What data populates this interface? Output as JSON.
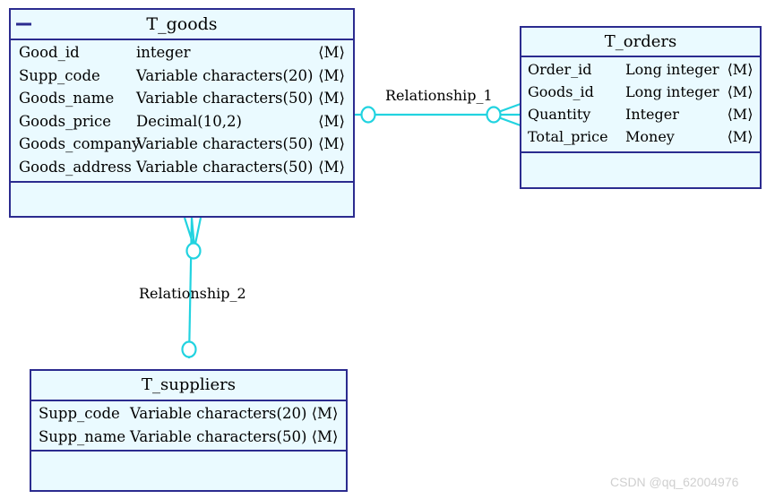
{
  "diagram": {
    "background_color": "#ffffff",
    "entity_border_color": "#2b2b8f",
    "entity_fill_color": "#eafaff",
    "relationship_color": "#22d3e0",
    "mandatory_marker": "⟨M⟩"
  },
  "entities": [
    {
      "id": "t_goods",
      "title": "T_goods",
      "has_collapse_dash": true,
      "attributes": [
        {
          "name": "Good_id",
          "type": "integer",
          "mandatory": "⟨M⟩"
        },
        {
          "name": "Supp_code",
          "type": "Variable characters(20)",
          "mandatory": "⟨M⟩"
        },
        {
          "name": "Goods_name",
          "type": "Variable characters(50)",
          "mandatory": "⟨M⟩"
        },
        {
          "name": "Goods_price",
          "type": "Decimal(10,2)",
          "mandatory": "⟨M⟩"
        },
        {
          "name": "Goods_company",
          "type": "Variable characters(50)",
          "mandatory": "⟨M⟩"
        },
        {
          "name": "Goods_address",
          "type": "Variable characters(50)",
          "mandatory": "⟨M⟩"
        }
      ]
    },
    {
      "id": "t_orders",
      "title": "T_orders",
      "has_collapse_dash": false,
      "attributes": [
        {
          "name": "Order_id",
          "type": "Long integer",
          "mandatory": "⟨M⟩"
        },
        {
          "name": "Goods_id",
          "type": "Long integer",
          "mandatory": "⟨M⟩"
        },
        {
          "name": "Quantity",
          "type": "Integer",
          "mandatory": "⟨M⟩"
        },
        {
          "name": "Total_price",
          "type": "Money",
          "mandatory": "⟨M⟩"
        }
      ]
    },
    {
      "id": "t_suppliers",
      "title": "T_suppliers",
      "has_collapse_dash": false,
      "attributes": [
        {
          "name": "Supp_code",
          "type": "Variable characters(20)",
          "mandatory": "⟨M⟩"
        },
        {
          "name": "Supp_name",
          "type": "Variable characters(50)",
          "mandatory": "⟨M⟩"
        }
      ]
    }
  ],
  "relationships": [
    {
      "id": "relationship_1",
      "label": "Relationship_1",
      "from": "T_goods",
      "to": "T_orders",
      "from_cardinality": "zero-or-one",
      "to_cardinality": "zero-or-many"
    },
    {
      "id": "relationship_2",
      "label": "Relationship_2",
      "from": "T_goods",
      "to": "T_suppliers",
      "from_cardinality": "zero-or-many",
      "to_cardinality": "zero-or-one"
    }
  ],
  "watermark": {
    "text": "CSDN @qq_62004976"
  }
}
